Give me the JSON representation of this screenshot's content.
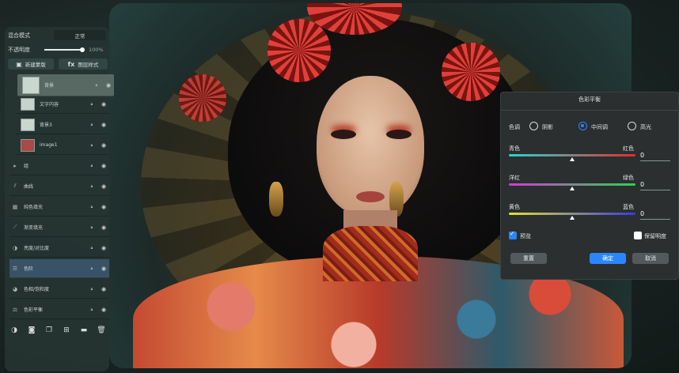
{
  "layers_panel": {
    "blend_mode_label": "混合模式",
    "blend_mode_value": "正常",
    "opacity_label": "不透明度",
    "opacity_value": "100%",
    "opacity_fraction": 1.0,
    "new_mask_label": "新建蒙版",
    "fx_label": "fx",
    "layer_style_label": "图层样式",
    "layers": [
      {
        "name": "背景",
        "kind": "image",
        "thumb_color": "#c9d7cf"
      },
      {
        "name": "文字内容",
        "kind": "text",
        "thumb_color": "#c6d2cc"
      },
      {
        "name": "背景3",
        "kind": "image",
        "thumb_color": "#c9d7cf"
      },
      {
        "name": "image1",
        "kind": "image",
        "thumb_color": "#a94a46"
      },
      {
        "name": "组",
        "kind": "group"
      },
      {
        "name": "曲线",
        "kind": "adjust"
      },
      {
        "name": "纯色填充",
        "kind": "adjust"
      },
      {
        "name": "渐变填充",
        "kind": "adjust"
      },
      {
        "name": "亮度/对比度",
        "kind": "adjust"
      },
      {
        "name": "色阶",
        "kind": "adjust",
        "selected": true
      },
      {
        "name": "色相/饱和度",
        "kind": "adjust"
      },
      {
        "name": "色彩平衡",
        "kind": "adjust"
      }
    ],
    "bottom_tools": [
      "adjust-icon",
      "mask-icon",
      "duplicate-icon",
      "add-layer-icon",
      "folder-icon",
      "trash-icon"
    ]
  },
  "color_balance": {
    "title": "色彩平衡",
    "tone_label": "色调",
    "tones": [
      "阴影",
      "中间调",
      "高光"
    ],
    "selected_tone": "中间调",
    "sliders": [
      {
        "left": "青色",
        "right": "红色",
        "value": "0",
        "gradient": [
          "#2ad4d0",
          "#e0302c"
        ]
      },
      {
        "left": "洋红",
        "right": "绿色",
        "value": "0",
        "gradient": [
          "#d43ad4",
          "#2ad44a"
        ]
      },
      {
        "left": "黄色",
        "right": "蓝色",
        "value": "0",
        "gradient": [
          "#e4e02a",
          "#3a3ae4"
        ]
      }
    ],
    "preview_label": "预览",
    "preview_checked": true,
    "preserve_label": "保留明度",
    "preserve_checked": false,
    "reset_label": "重置",
    "ok_label": "确定",
    "cancel_label": "取消"
  },
  "colors": {
    "accent": "#2a86ff",
    "panel": "#263432",
    "dialog": "#2b2f30",
    "selected_layer": "#3a5266"
  }
}
